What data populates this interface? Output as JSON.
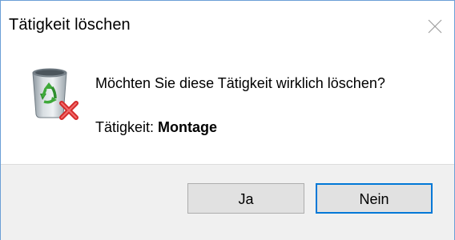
{
  "window": {
    "title": "Tätigkeit löschen",
    "close_icon": "close-icon"
  },
  "message": {
    "icon": "recycle-bin-delete-icon",
    "question": "Möchten Sie diese Tätigkeit wirklich löschen?",
    "detail_label": "Tätigkeit:",
    "detail_value": "Montage"
  },
  "buttons": {
    "yes_label": "Ja",
    "no_label": "Nein",
    "default": "no"
  },
  "colors": {
    "window_border": "#6b9fd6",
    "footer_background": "#f0f0f0",
    "button_background": "#e1e1e1",
    "default_button_border": "#0078d7",
    "delete_mark": "#d42a2a"
  }
}
